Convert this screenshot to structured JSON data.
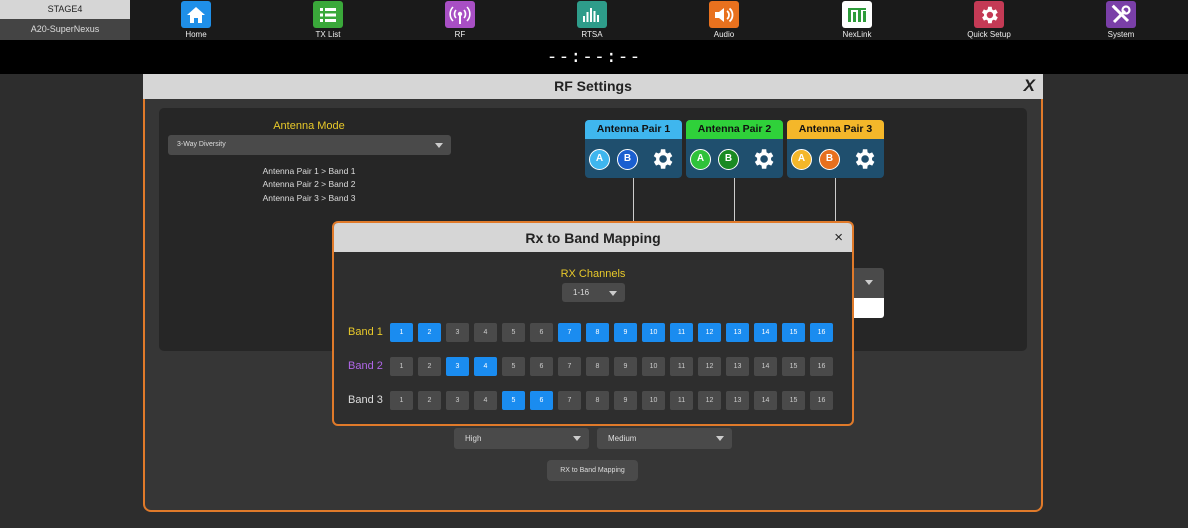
{
  "device": {
    "name": "STAGE4",
    "model": "A20-SuperNexus"
  },
  "nav": [
    {
      "label": "Home",
      "icon": "home-icon",
      "color": "#1f8fe8"
    },
    {
      "label": "TX List",
      "icon": "list-icon",
      "color": "#3aa83a"
    },
    {
      "label": "RF",
      "icon": "antenna-icon",
      "color": "#a84fc4"
    },
    {
      "label": "RTSA",
      "icon": "spectrum-icon",
      "color": "#2e9c8a"
    },
    {
      "label": "Audio",
      "icon": "speaker-icon",
      "color": "#e8711e"
    },
    {
      "label": "NexLink",
      "icon": "nexlink-icon",
      "color": "#ffffff"
    },
    {
      "label": "Quick Setup",
      "icon": "gear-icon",
      "color": "#c43a55"
    },
    {
      "label": "System",
      "icon": "tools-icon",
      "color": "#7a3fa8"
    }
  ],
  "clock": "--:--:--",
  "rf": {
    "title": "RF Settings",
    "close": "X",
    "antenna_mode_label": "Antenna Mode",
    "antenna_mode_value": "3-Way Diversity",
    "mapping": [
      "Antenna Pair 1 > Band 1",
      "Antenna Pair 2 > Band 2",
      "Antenna Pair 3 > Band 3"
    ],
    "pairs": [
      {
        "label": "Antenna Pair 1",
        "color": "#3fb6ee",
        "a": "A",
        "b": "B",
        "a_color": "#3fb6ee",
        "b_color": "#1a5fd0"
      },
      {
        "label": "Antenna Pair 2",
        "color": "#2fd13a",
        "a": "A",
        "b": "B",
        "a_color": "#2fc23a",
        "b_color": "#1a8a22"
      },
      {
        "label": "Antenna Pair 3",
        "color": "#f4b72a",
        "a": "A",
        "b": "B",
        "a_color": "#f4b72a",
        "b_color": "#e8701e"
      }
    ],
    "select_high": "High",
    "select_medium": "Medium",
    "mapping_button": "RX to Band Mapping"
  },
  "modal": {
    "title": "Rx to Band Mapping",
    "close": "×",
    "rx_channels_label": "RX Channels",
    "rx_channels_value": "1-16",
    "bands": [
      {
        "label": "Band 1",
        "color": "#e8c92a",
        "on": [
          1,
          2,
          7,
          8,
          9,
          10,
          11,
          12,
          13,
          14,
          15,
          16
        ]
      },
      {
        "label": "Band 2",
        "color": "#b066e8",
        "on": [
          3,
          4
        ]
      },
      {
        "label": "Band 3",
        "color": "#dddddd",
        "on": [
          5,
          6
        ]
      }
    ],
    "channels": [
      "1",
      "2",
      "3",
      "4",
      "5",
      "6",
      "7",
      "8",
      "9",
      "10",
      "11",
      "12",
      "13",
      "14",
      "15",
      "16"
    ]
  }
}
